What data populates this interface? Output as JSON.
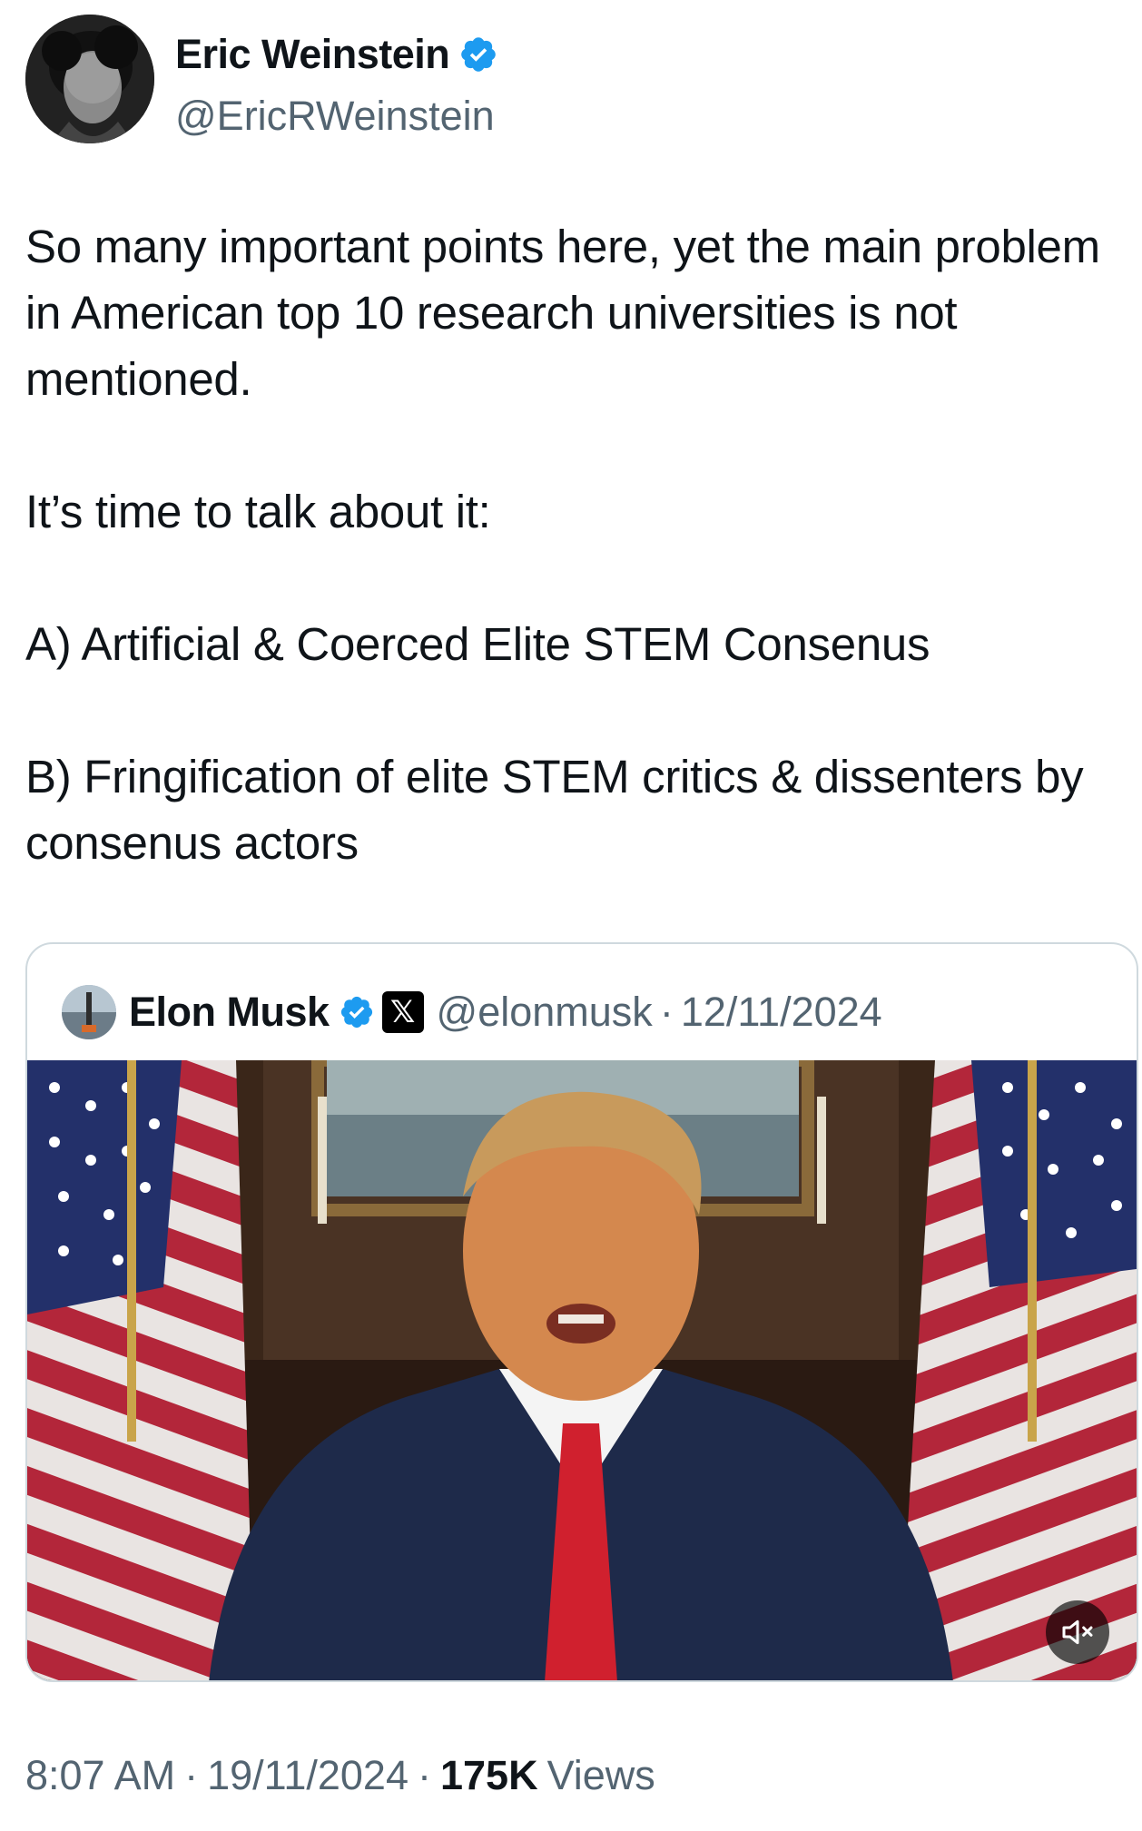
{
  "author": {
    "display_name": "Eric Weinstein",
    "handle": "@EricRWeinstein",
    "avatar_icon": "avatar-photo",
    "verified": true
  },
  "tweet": {
    "text": "So many important points here, yet the main problem in American top 10 research universities is not mentioned.\n\nIt’s time to talk about it:\n\nA) Artificial & Coerced Elite STEM Consenus\n\nB) Fringification of elite STEM critics & dissenters by consenus actors"
  },
  "quoted": {
    "display_name": "Elon Musk",
    "handle": "@elonmusk",
    "separator": "·",
    "date": "12/11/2024",
    "verified": true,
    "affiliate_badge_icon": "x-logo-icon",
    "media_icon": "video-thumbnail",
    "mute_icon": "speaker-muted-icon"
  },
  "footer": {
    "time": "8:07 AM",
    "sep1": "·",
    "date": "19/11/2024",
    "sep2": "·",
    "views_count": "175K",
    "views_label": "Views"
  },
  "colors": {
    "text": "#0f1419",
    "secondary": "#536471",
    "verified_blue": "#1d9bf0",
    "border": "#cfd9de"
  }
}
